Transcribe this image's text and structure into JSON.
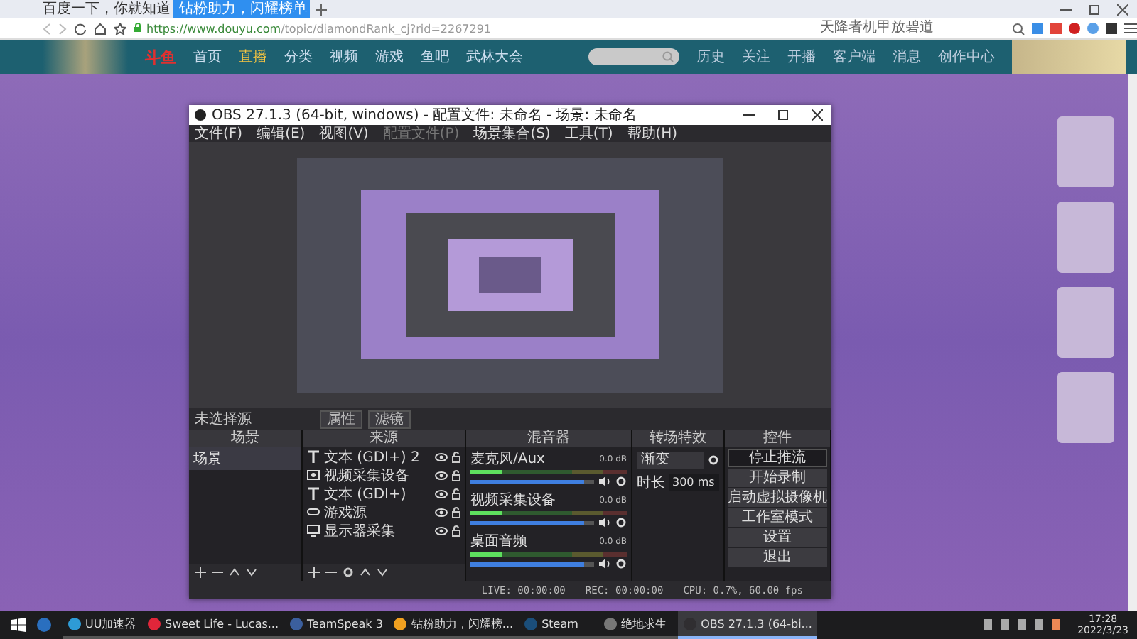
{
  "browser": {
    "tabs": [
      {
        "label": "百度一下，你就知道",
        "selected": false
      },
      {
        "label": "钻粉助力，闪耀榜单",
        "selected": true
      }
    ],
    "url": {
      "host": "https://www.douyu.com",
      "path": "/topic/diamondRank_cj?rid=2267291"
    },
    "search": {
      "value": "天降者机甲放碧道"
    }
  },
  "site": {
    "logo": "斗鱼",
    "nav": [
      {
        "label": "首页",
        "selected": false
      },
      {
        "label": "直播",
        "selected": true
      },
      {
        "label": "分类",
        "selected": false
      },
      {
        "label": "视频",
        "selected": false
      },
      {
        "label": "游戏",
        "selected": false
      },
      {
        "label": "鱼吧",
        "selected": false
      },
      {
        "label": "武林大会",
        "selected": false
      }
    ],
    "actions": [
      "历史",
      "关注",
      "开播",
      "客户端",
      "消息",
      "创作中心"
    ]
  },
  "obs": {
    "title": "OBS 27.1.3 (64-bit, windows) - 配置文件: 未命名 - 场景: 未命名",
    "menu": [
      {
        "label": "文件(F)",
        "disabled": false
      },
      {
        "label": "编辑(E)",
        "disabled": false
      },
      {
        "label": "视图(V)",
        "disabled": false
      },
      {
        "label": "配置文件(P)",
        "disabled": true
      },
      {
        "label": "场景集合(S)",
        "disabled": false
      },
      {
        "label": "工具(T)",
        "disabled": false
      },
      {
        "label": "帮助(H)",
        "disabled": false
      }
    ],
    "no_source": "未选择源",
    "source_buttons": [
      "属性",
      "滤镜"
    ],
    "scenes": {
      "title": "场景",
      "items": [
        {
          "label": "场景",
          "selected": true
        }
      ]
    },
    "sources": {
      "title": "来源",
      "items": [
        {
          "label": "文本 (GDI+) 2",
          "kind": "text",
          "visible": true
        },
        {
          "label": "视频采集设备",
          "kind": "camera",
          "visible": true
        },
        {
          "label": "文本 (GDI+)",
          "kind": "text",
          "visible": true
        },
        {
          "label": "游戏源",
          "kind": "gamepad",
          "visible": true
        },
        {
          "label": "显示器采集",
          "kind": "monitor",
          "visible": true
        }
      ]
    },
    "mixer": {
      "title": "混音器",
      "channels": [
        {
          "name": "麦克风/Aux",
          "reading": "0.0 dB",
          "level": 0.92
        },
        {
          "name": "视频采集设备",
          "reading": "0.0 dB",
          "level": 0.92
        },
        {
          "name": "桌面音频",
          "reading": "0.0 dB",
          "level": 0.92
        }
      ]
    },
    "transitions": {
      "title": "转场特效",
      "type": "渐变",
      "duration_label": "时长",
      "duration": "300 ms"
    },
    "controls": {
      "title": "控件",
      "buttons": [
        {
          "label": "停止推流",
          "active": true
        },
        {
          "label": "开始录制",
          "active": false
        },
        {
          "label": "启动虚拟摄像机",
          "active": false
        },
        {
          "label": "工作室模式",
          "active": false
        },
        {
          "label": "设置",
          "active": false
        },
        {
          "label": "退出",
          "active": false
        }
      ]
    },
    "status": {
      "live": "LIVE: 00:00:00",
      "rec": "REC: 00:00:00",
      "cpu": "CPU: 0.7%, 60.00 fps"
    }
  },
  "taskbar": {
    "items": [
      {
        "label": "UU加速器",
        "color": "#2e9bd6",
        "selected": false
      },
      {
        "label": "Sweet Life - Lucas...",
        "color": "#e0263a",
        "selected": false
      },
      {
        "label": "TeamSpeak 3",
        "color": "#3b5f9e",
        "selected": false
      },
      {
        "label": "钻粉助力，闪耀榜...",
        "color": "#f0a020",
        "selected": false
      },
      {
        "label": "Steam",
        "color": "#1b4e7a",
        "selected": false
      },
      {
        "label": "绝地求生",
        "color": "#777777",
        "selected": false
      },
      {
        "label": "OBS 27.1.3 (64-bi...",
        "color": "#302e31",
        "selected": true
      }
    ],
    "time": "17:28",
    "date": "2022/3/23"
  }
}
